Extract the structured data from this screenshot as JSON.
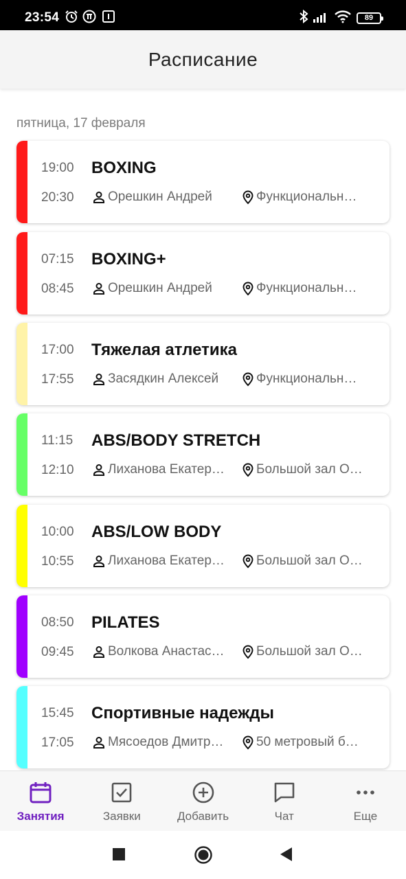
{
  "status_bar": {
    "time": "23:54",
    "battery": "89"
  },
  "header": {
    "title": "Расписание"
  },
  "date_label": "пятница, 17 февраля",
  "classes": [
    {
      "start": "19:00",
      "end": "20:30",
      "title": "BOXING",
      "trainer": "Орешкин Андрей",
      "location": "Функциональн…",
      "color": "#ff1a1a"
    },
    {
      "start": "07:15",
      "end": "08:45",
      "title": "BOXING+",
      "trainer": "Орешкин Андрей",
      "location": "Функциональн…",
      "color": "#ff1a1a"
    },
    {
      "start": "17:00",
      "end": "17:55",
      "title": "Тяжелая атлетика",
      "trainer": "Засядкин Алексей",
      "location": "Функциональн…",
      "color": "#fff3a8"
    },
    {
      "start": "11:15",
      "end": "12:10",
      "title": "ABS/BODY STRETCH",
      "trainer": "Лиханова Екатер…",
      "location": "Большой зал О…",
      "color": "#66ff66"
    },
    {
      "start": "10:00",
      "end": "10:55",
      "title": "ABS/LOW BODY",
      "trainer": "Лиханова Екатер…",
      "location": "Большой зал О…",
      "color": "#ffff00"
    },
    {
      "start": "08:50",
      "end": "09:45",
      "title": "PILATES",
      "trainer": "Волкова Анастас…",
      "location": "Большой зал О…",
      "color": "#a000ff"
    },
    {
      "start": "15:45",
      "end": "17:05",
      "title": "Спортивные надежды",
      "trainer": "Мясоедов Дмитр…",
      "location": "50 метровый б…",
      "color": "#55ffff"
    }
  ],
  "bottom_nav": [
    {
      "label": "Занятия",
      "icon": "calendar-icon",
      "active": true
    },
    {
      "label": "Заявки",
      "icon": "checkbox-icon",
      "active": false
    },
    {
      "label": "Добавить",
      "icon": "add-circle-icon",
      "active": false
    },
    {
      "label": "Чат",
      "icon": "chat-icon",
      "active": false
    },
    {
      "label": "Еще",
      "icon": "more-icon",
      "active": false
    }
  ],
  "colors": {
    "accent": "#7020c0",
    "inactive": "#666666"
  }
}
